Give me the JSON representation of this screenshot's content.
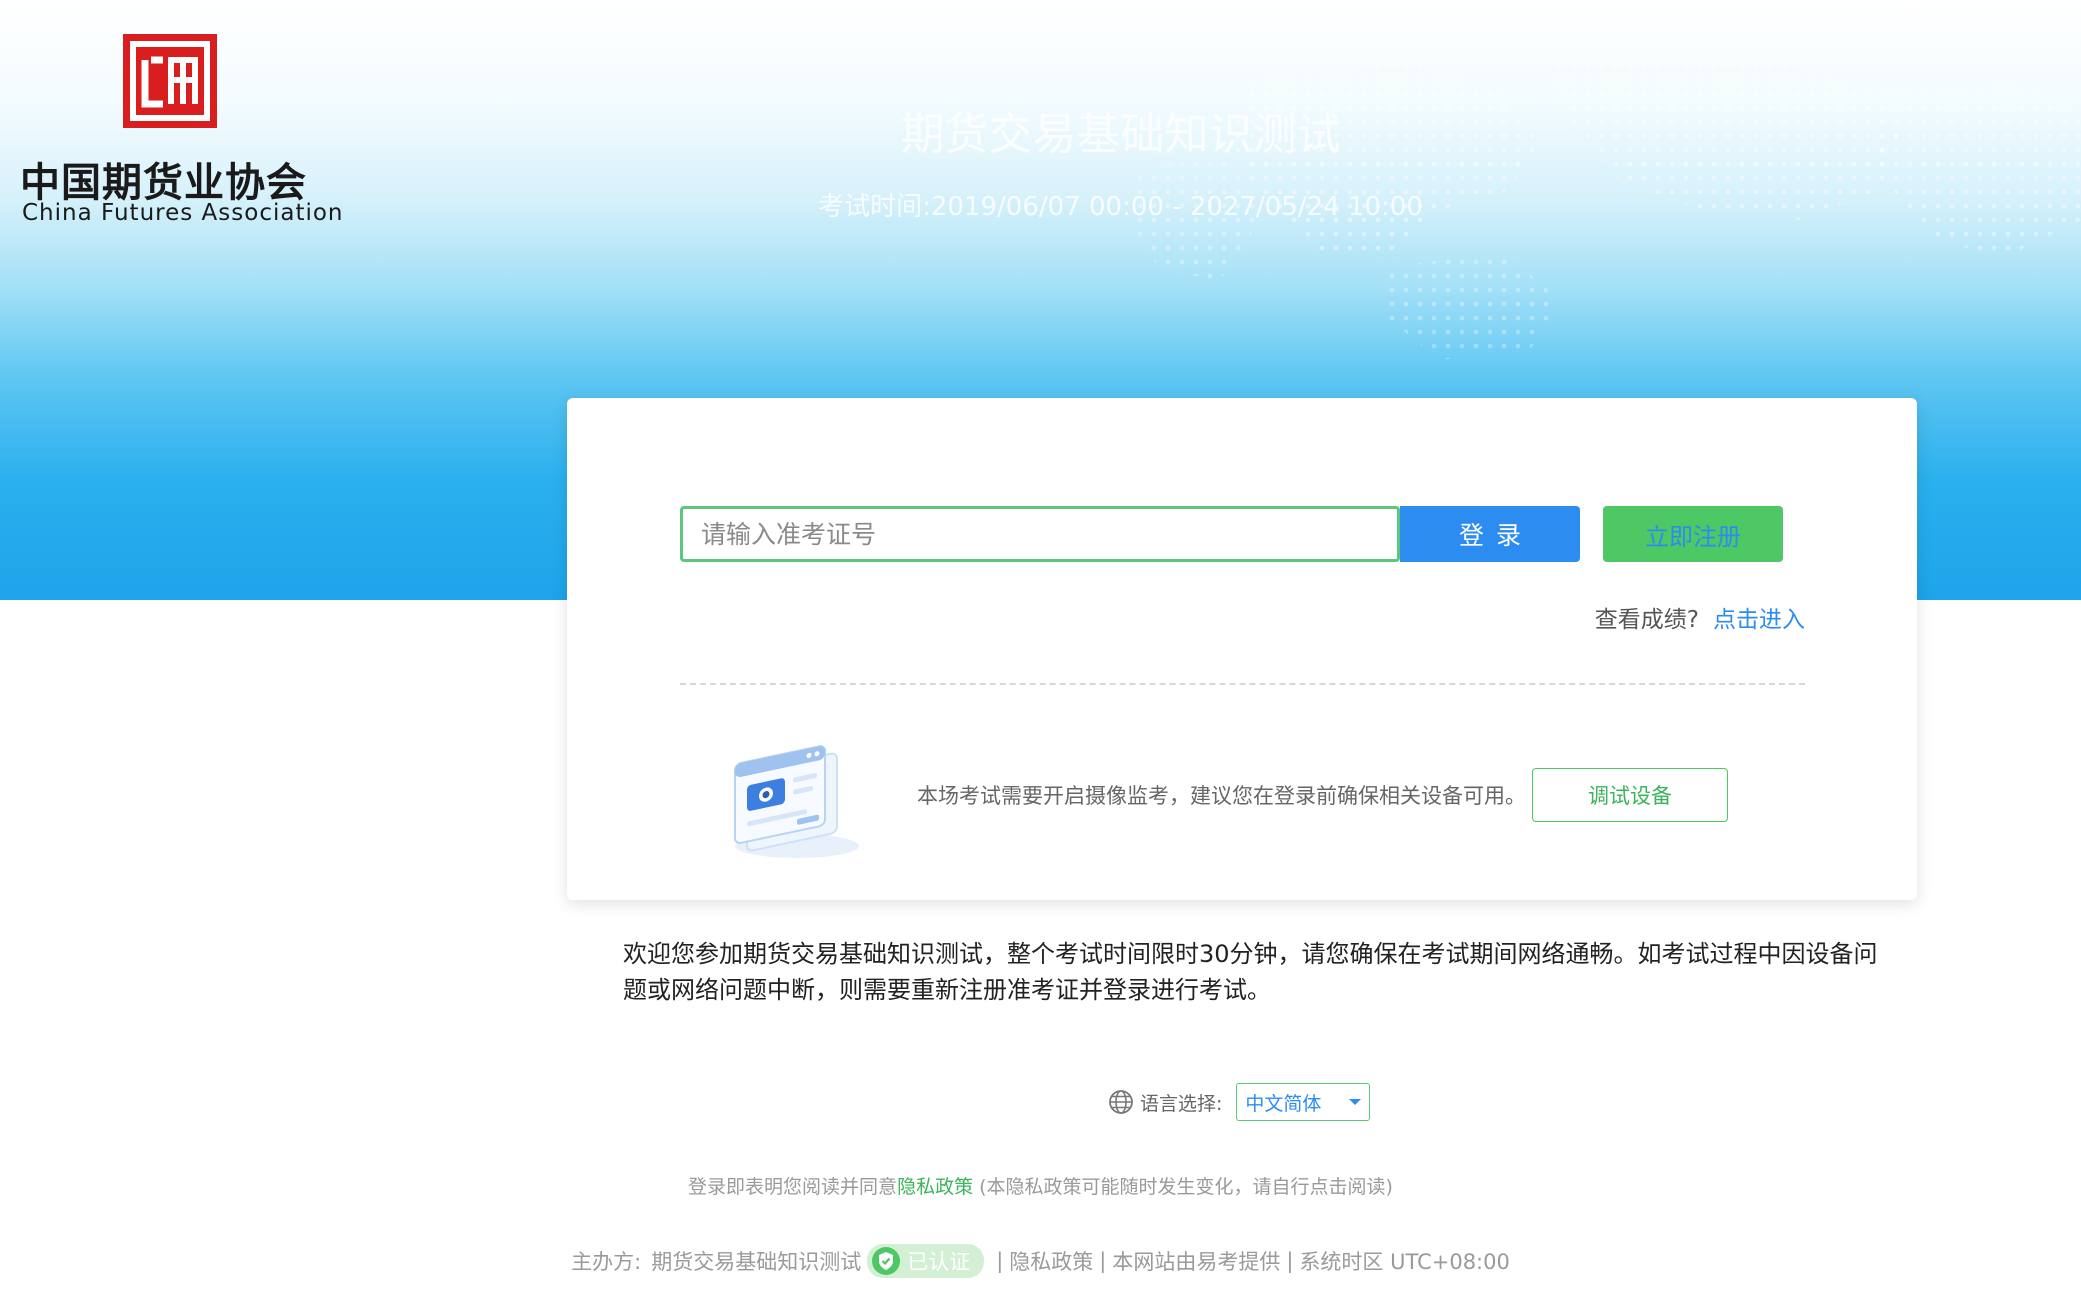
{
  "header": {
    "logo_cn": "中国期货业协会",
    "logo_en": "China Futures Association",
    "logo_mark_text": "CFA",
    "exam_title": "期货交易基础知识测试",
    "exam_time": "考试时间:2019/06/07 00:00 - 2027/05/24 10:00"
  },
  "login": {
    "input_placeholder": "请输入准考证号",
    "login_label": "登录",
    "register_label": "立即注册",
    "score_label": "查看成绩?",
    "score_link": "点击进入"
  },
  "camera": {
    "note": "本场考试需要开启摄像监考，建议您在登录前确保相关设备可用。",
    "debug_label": "调试设备"
  },
  "notice": "欢迎您参加期货交易基础知识测试，整个考试时间限时30分钟，请您确保在考试期间网络通畅。如考试过程中因设备问题或网络问题中断，则需要重新注册准考证并登录进行考试。",
  "language": {
    "label": "语言选择:",
    "selected": "中文简体"
  },
  "privacy": {
    "prefix": "登录即表明您阅读并同意",
    "link": "隐私政策",
    "suffix": " (本隐私政策可能随时发生变化，请自行点击阅读)"
  },
  "footer": {
    "host_label": "主办方:",
    "host_name": "期货交易基础知识测试",
    "verified": "已认证",
    "privacy_link": "隐私政策",
    "provider": "本网站由易考提供",
    "timezone": "系统时区 UTC+08:00"
  },
  "colors": {
    "primary_blue": "#2d8cf0",
    "primary_green": "#4ec765",
    "logo_red": "#d81e1e"
  },
  "icons": {
    "globe": "globe-icon",
    "shield": "shield-check-icon",
    "caret": "chevron-down-icon"
  }
}
